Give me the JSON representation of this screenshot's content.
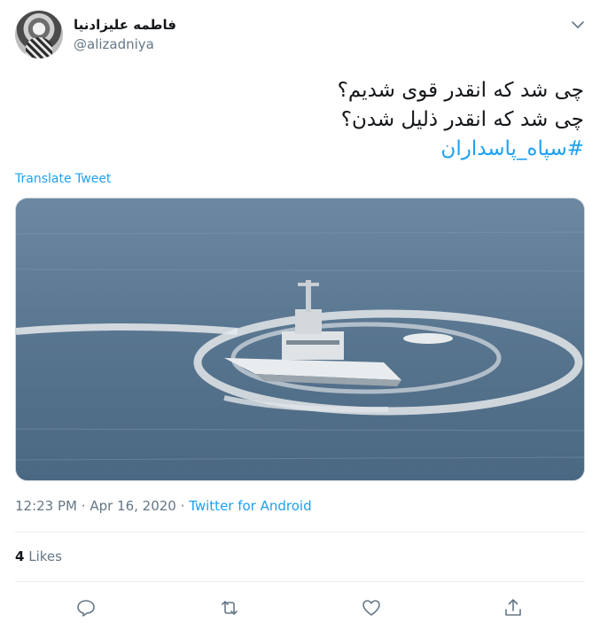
{
  "user": {
    "display_name": "فاطمه علیزادنیا",
    "handle": "@alizadniya"
  },
  "tweet": {
    "line1": "چی شد که انقدر قوی شدیم؟",
    "line2": "چی شد که انقدر ذلیل شدن؟",
    "hashtag": "#سپاه_پاسداران"
  },
  "translate_label": "Translate Tweet",
  "meta": {
    "time": "12:23 PM",
    "separator": "·",
    "date": "Apr 16, 2020",
    "separator2": "·",
    "client": "Twitter for Android"
  },
  "likes": {
    "count": "4",
    "label": "Likes"
  },
  "icons": {
    "caret": "chevron-down-icon",
    "reply": "reply-icon",
    "retweet": "retweet-icon",
    "like": "heart-icon",
    "share": "share-icon"
  },
  "colors": {
    "accent": "#1da1f2",
    "secondary_text": "#657786",
    "divider": "#e6ecf0"
  }
}
